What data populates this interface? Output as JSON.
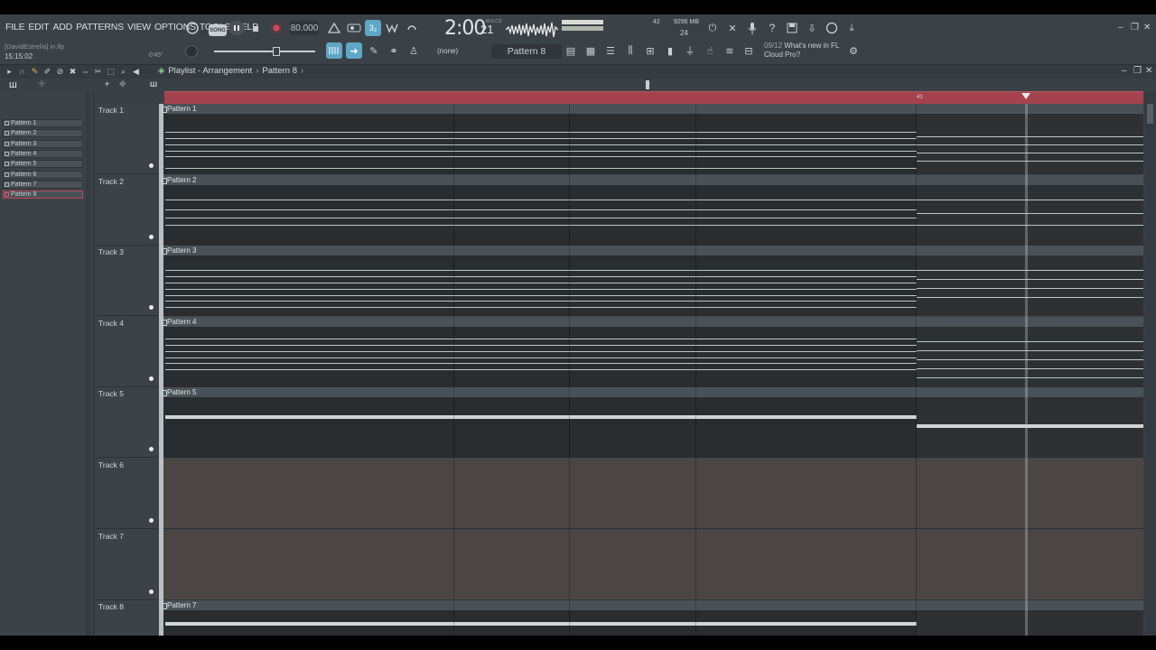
{
  "menu": [
    "FILE",
    "EDIT",
    "ADD",
    "PATTERNS",
    "VIEW",
    "OPTIONS",
    "TOOLS",
    "HELP"
  ],
  "hint": {
    "title": "[DavidEstrella] in.flp",
    "time": "15:15:02"
  },
  "transport": {
    "song_label": "SONG",
    "tempo": "80.000",
    "time_main": "2:00",
    "time_sub": "21",
    "time_label": "M:S:CS",
    "pitch": "0'45\""
  },
  "monitor": {
    "cpu": "42",
    "memory": "9296 MB",
    "polyphony": "24"
  },
  "pattern_selector": {
    "snap": "(none)",
    "current": "Pattern 8"
  },
  "news": {
    "count": "09/12",
    "line1": "What's new in FL",
    "line2": "Cloud Pro?"
  },
  "playlist": {
    "title": "Playlist - Arrangement",
    "current_pattern": "Pattern 8",
    "ruler_label": "41"
  },
  "picker": [
    "Pattern 1",
    "Pattern 2",
    "Pattern 3",
    "Pattern 4",
    "Pattern 5",
    "Pattern 6",
    "Pattern 7",
    "Pattern 8"
  ],
  "tracks": [
    {
      "name": "Track 1",
      "clip": "Pattern 1"
    },
    {
      "name": "Track 2",
      "clip": "Pattern 2"
    },
    {
      "name": "Track 3",
      "clip": "Pattern 3"
    },
    {
      "name": "Track 4",
      "clip": "Pattern 4"
    },
    {
      "name": "Track 5",
      "clip": "Pattern 5"
    },
    {
      "name": "Track 6",
      "clip": ""
    },
    {
      "name": "Track 7",
      "clip": ""
    },
    {
      "name": "Track 8",
      "clip": "Pattern 7"
    }
  ],
  "colors": {
    "ruler": "#a4424e",
    "accent": "#e05a78"
  }
}
